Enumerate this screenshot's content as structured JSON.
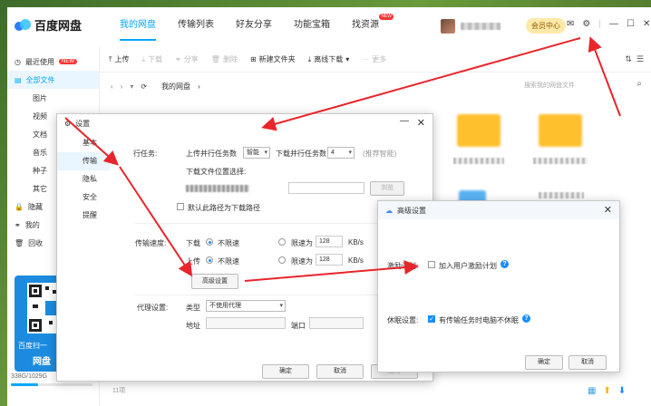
{
  "app": {
    "name": "百度网盘"
  },
  "nav": [
    {
      "label": "我的网盘",
      "active": true
    },
    {
      "label": "传输列表"
    },
    {
      "label": "好友分享"
    },
    {
      "label": "功能宝箱"
    },
    {
      "label": "找资源",
      "badge": "NEW"
    }
  ],
  "header": {
    "vip_label": "会员中心"
  },
  "toolbar": {
    "upload": "上传",
    "download": "下载",
    "share": "分享",
    "delete": "删除",
    "new_folder": "新建文件夹",
    "offline": "离线下载",
    "more": "更多"
  },
  "path": {
    "current": "我的网盘",
    "search_placeholder": "搜索我的网盘文件"
  },
  "sidebar": {
    "items": [
      {
        "label": "最近使用",
        "badge": "NEW"
      },
      {
        "label": "全部文件"
      },
      {
        "label": "图片"
      },
      {
        "label": "视频"
      },
      {
        "label": "文档"
      },
      {
        "label": "音乐"
      },
      {
        "label": "种子"
      },
      {
        "label": "其它"
      },
      {
        "label": "隐藏"
      },
      {
        "label": "我的"
      },
      {
        "label": "回收"
      }
    ],
    "qr_text": "百度扫一",
    "qr_text2": "网盘",
    "storage": "338G/1029G"
  },
  "status": {
    "item_count": "11项"
  },
  "settings": {
    "title": "设置",
    "tabs": [
      "基本",
      "传输",
      "隐私",
      "安全",
      "提醒"
    ],
    "upload_task_label": "上传并行任务数",
    "upload_task_value": "智能",
    "download_task_label": "下载并行任务数",
    "download_task_value": "4",
    "recommend": "(推荐智能)",
    "download_location_label": "下载文件位置选择:",
    "browse": "浏览",
    "default_path": "默认此路径为下载路径",
    "speed_label": "传输速度:",
    "download": "下载",
    "upload": "上传",
    "no_limit": "不限速",
    "limit_to": "限速为",
    "speed_value": "128",
    "unit": "KB/s",
    "advanced_btn": "高级设置",
    "proxy_label": "代理设置:",
    "type_label": "类型",
    "proxy_value": "不使用代理",
    "address_label": "地址",
    "port_label": "端口",
    "ok": "确定",
    "cancel": "取消",
    "apply": "应用"
  },
  "advanced": {
    "title": "高级设置",
    "incentive_label": "激励计划:",
    "incentive_option": "加入用户激励计划",
    "sleep_label": "休眠设置:",
    "sleep_option": "有传输任务时电脑不休眠",
    "ok": "确定",
    "cancel": "取消"
  },
  "colors": {
    "accent": "#06a7ff",
    "arrow": "#e8252b"
  }
}
